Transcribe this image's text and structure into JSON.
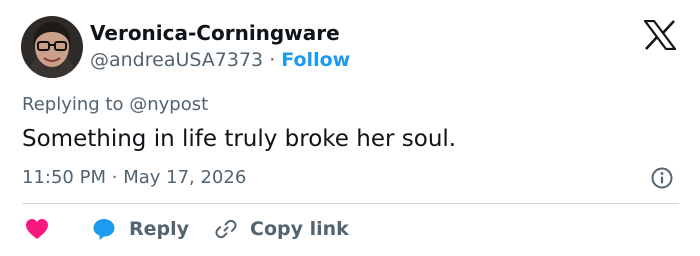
{
  "author": {
    "display_name": "Veronica-Corningware",
    "handle": "@andreaUSA7373",
    "separator": "·",
    "follow_label": "Follow"
  },
  "reply_context": {
    "prefix": "Replying to",
    "mention": "@nypost"
  },
  "tweet": {
    "text": "Something in life truly broke her soul.",
    "time": "11:50 PM",
    "separator": "·",
    "date": "May 17, 2026"
  },
  "actions": {
    "like_icon": "heart-icon",
    "reply_label": "Reply",
    "reply_icon": "speech-bubble-icon",
    "copy_label": "Copy link",
    "copy_icon": "link-icon"
  },
  "colors": {
    "accent": "#1d9bf0",
    "like": "#f91880",
    "text_primary": "#0f1419",
    "text_secondary": "#536471",
    "divider": "#cfd9de"
  }
}
